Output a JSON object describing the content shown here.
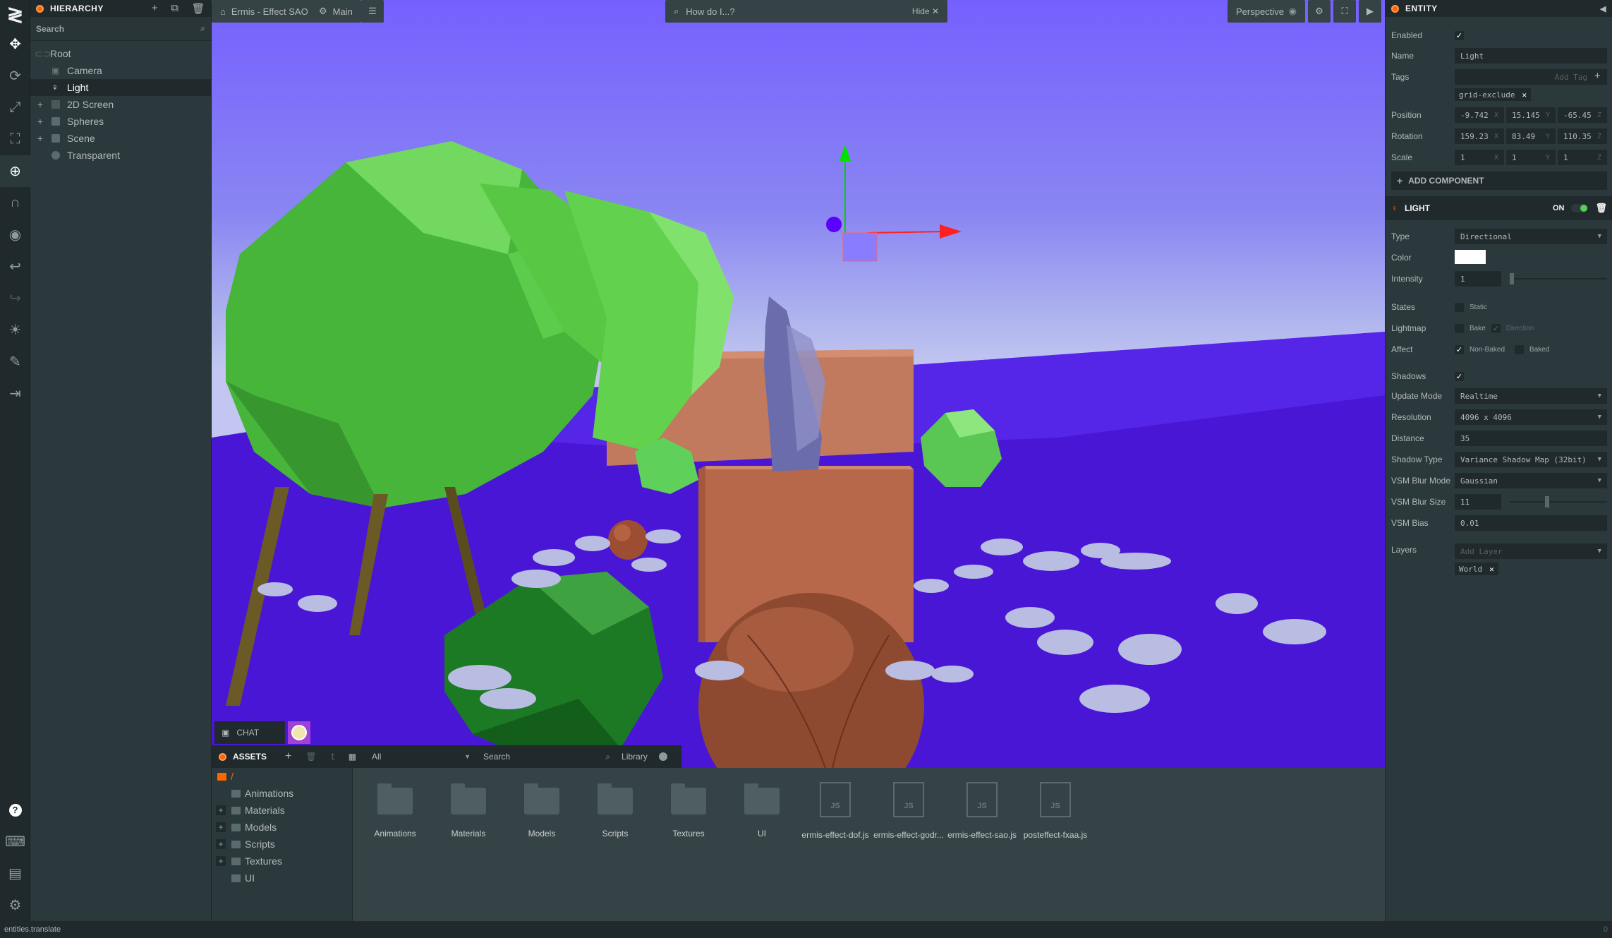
{
  "toolbar": {
    "logo": "≷"
  },
  "hierarchy": {
    "title": "HIERARCHY",
    "search_label": "Search",
    "items": [
      {
        "label": "Root",
        "icon": "root-icon"
      },
      {
        "label": "Camera",
        "icon": "camera-icon"
      },
      {
        "label": "Light",
        "icon": "light-icon"
      },
      {
        "label": "2D Screen",
        "icon": "screen-icon"
      },
      {
        "label": "Spheres",
        "icon": "folder-icon"
      },
      {
        "label": "Scene",
        "icon": "folder-icon"
      },
      {
        "label": "Transparent",
        "icon": "entity-icon"
      }
    ]
  },
  "viewport": {
    "project_label": "Ermis - Effect SAO",
    "scene_label": "Main",
    "search_placeholder": "How do I...?",
    "hide_label": "Hide",
    "camera_label": "Perspective"
  },
  "chat": {
    "label": "CHAT"
  },
  "assets": {
    "title": "ASSETS",
    "filter": "All",
    "search_label": "Search",
    "library_label": "Library",
    "root": "/",
    "tree": [
      {
        "label": "Animations",
        "expandable": false
      },
      {
        "label": "Materials",
        "expandable": true
      },
      {
        "label": "Models",
        "expandable": true
      },
      {
        "label": "Scripts",
        "expandable": true
      },
      {
        "label": "Textures",
        "expandable": true
      },
      {
        "label": "UI",
        "expandable": false
      }
    ],
    "tiles": [
      {
        "name": "Animations",
        "type": "folder"
      },
      {
        "name": "Materials",
        "type": "folder"
      },
      {
        "name": "Models",
        "type": "folder"
      },
      {
        "name": "Scripts",
        "type": "folder"
      },
      {
        "name": "Textures",
        "type": "folder"
      },
      {
        "name": "UI",
        "type": "folder"
      },
      {
        "name": "ermis-effect-dof.js",
        "type": "js"
      },
      {
        "name": "ermis-effect-godr...",
        "type": "js"
      },
      {
        "name": "ermis-effect-sao.js",
        "type": "js"
      },
      {
        "name": "posteffect-fxaa.js",
        "type": "js"
      }
    ],
    "js_badge": "JS"
  },
  "inspector": {
    "entity_title": "ENTITY",
    "enabled_label": "Enabled",
    "name_label": "Name",
    "name_value": "Light",
    "tags_label": "Tags",
    "add_tag_placeholder": "Add Tag",
    "tag": "grid-exclude",
    "position_label": "Position",
    "position": [
      "-9.742",
      "15.145",
      "-65.45"
    ],
    "rotation_label": "Rotation",
    "rotation": [
      "159.23",
      "83.49",
      "110.35"
    ],
    "scale_label": "Scale",
    "scale": [
      "1",
      "1",
      "1"
    ],
    "axes": [
      "X",
      "Y",
      "Z"
    ],
    "add_component": "ADD COMPONENT",
    "light_title": "LIGHT",
    "on_label": "ON",
    "type_label": "Type",
    "type_value": "Directional",
    "color_label": "Color",
    "color_value": "#ffffff",
    "intensity_label": "Intensity",
    "intensity_value": "1",
    "states_label": "States",
    "static_label": "Static",
    "lightmap_label": "Lightmap",
    "bake_label": "Bake",
    "direction_label": "Direction",
    "affect_label": "Affect",
    "nonbaked_label": "Non-Baked",
    "baked_label": "Baked",
    "shadows_label": "Shadows",
    "update_mode_label": "Update Mode",
    "update_mode_value": "Realtime",
    "resolution_label": "Resolution",
    "resolution_value": "4096 x 4096",
    "distance_label": "Distance",
    "distance_value": "35",
    "shadow_type_label": "Shadow Type",
    "shadow_type_value": "Variance Shadow Map (32bit)",
    "vsm_blur_mode_label": "VSM Blur Mode",
    "vsm_blur_mode_value": "Gaussian",
    "vsm_blur_size_label": "VSM Blur Size",
    "vsm_blur_size_value": "11",
    "vsm_bias_label": "VSM Bias",
    "vsm_bias_value": "0.01",
    "layers_label": "Layers",
    "add_layer_placeholder": "Add Layer",
    "layer": "World"
  },
  "statusbar": {
    "text": "entities.translate",
    "right": "0"
  }
}
